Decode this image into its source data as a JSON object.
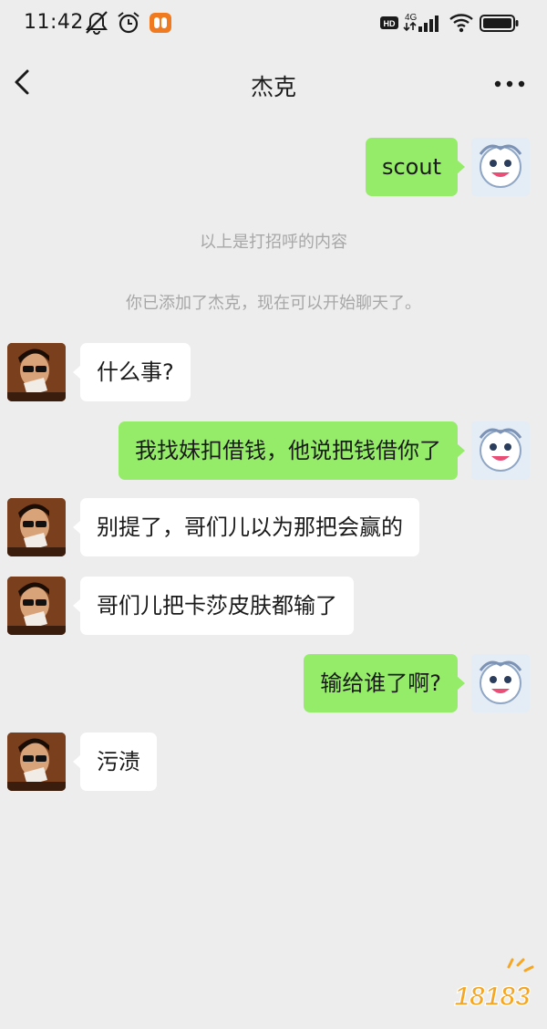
{
  "status_bar": {
    "time": "11:42",
    "network_label": "4G",
    "hd_label": "HD",
    "icons": [
      "mute-icon",
      "alarm-icon",
      "app-notification-icon",
      "hd-icon",
      "signal-icon",
      "wifi-icon",
      "battery-icon"
    ]
  },
  "nav": {
    "title": "杰克",
    "back_icon": "chevron-left-icon",
    "more_icon": "more-dots-icon"
  },
  "messages": [
    {
      "sender": "me",
      "text": "scout"
    },
    {
      "type": "system",
      "text": "以上是打招呼的内容"
    },
    {
      "type": "system",
      "text": "你已添加了杰克，现在可以开始聊天了。"
    },
    {
      "sender": "other",
      "text": "什么事?"
    },
    {
      "sender": "me",
      "text": "我找妹扣借钱，他说把钱借你了"
    },
    {
      "sender": "other",
      "text": "别提了，哥们儿以为那把会赢的"
    },
    {
      "sender": "other",
      "text": "哥们儿把卡莎皮肤都输了"
    },
    {
      "sender": "me",
      "text": "输给谁了啊?"
    },
    {
      "sender": "other",
      "text": "污渍"
    }
  ],
  "watermark": {
    "text": "18183"
  },
  "colors": {
    "background": "#ededed",
    "my_bubble": "#95ec69",
    "other_bubble": "#ffffff",
    "system_text": "#a7a7a7",
    "watermark_orange": "#f5a623"
  }
}
